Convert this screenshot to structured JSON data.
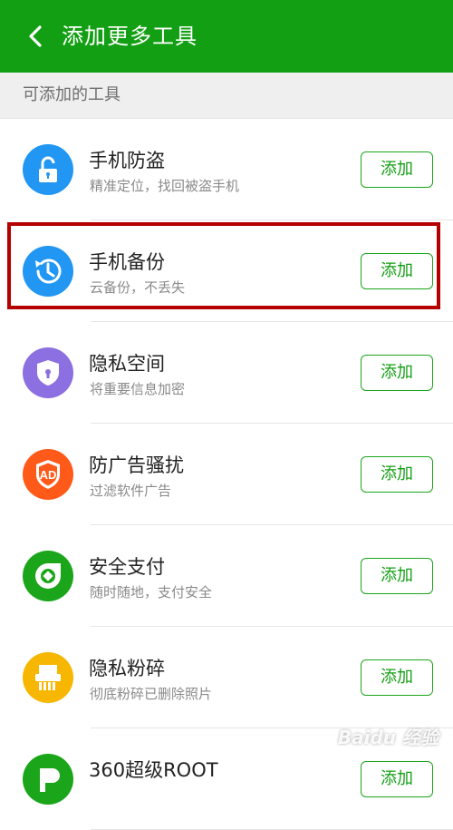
{
  "header": {
    "title": "添加更多工具",
    "bg_color": "#139f13"
  },
  "section": {
    "label": "可添加的工具"
  },
  "add_label": "添加",
  "items": [
    {
      "title": "手机防盗",
      "subtitle": "精准定位，找回被盗手机",
      "icon": "unlock-icon",
      "color": "#2196f3"
    },
    {
      "title": "手机备份",
      "subtitle": "云备份，不丢失",
      "icon": "clock-restore-icon",
      "color": "#2196f3",
      "highlighted": true
    },
    {
      "title": "隐私空间",
      "subtitle": "将重要信息加密",
      "icon": "shield-lock-icon",
      "color": "#8c6fe0"
    },
    {
      "title": "防广告骚扰",
      "subtitle": "过滤软件广告",
      "icon": "ad-shield-icon",
      "color": "#ff5a1a"
    },
    {
      "title": "安全支付",
      "subtitle": "随时随地，支付安全",
      "icon": "secure-pay-icon",
      "color": "#1aa51a"
    },
    {
      "title": "隐私粉碎",
      "subtitle": "彻底粉碎已删除照片",
      "icon": "shredder-icon",
      "color": "#f7b700"
    },
    {
      "title": "360超级ROOT",
      "subtitle": "",
      "icon": "root-icon",
      "color": "#1aa51a"
    }
  ],
  "watermark": "Baidu 经验"
}
